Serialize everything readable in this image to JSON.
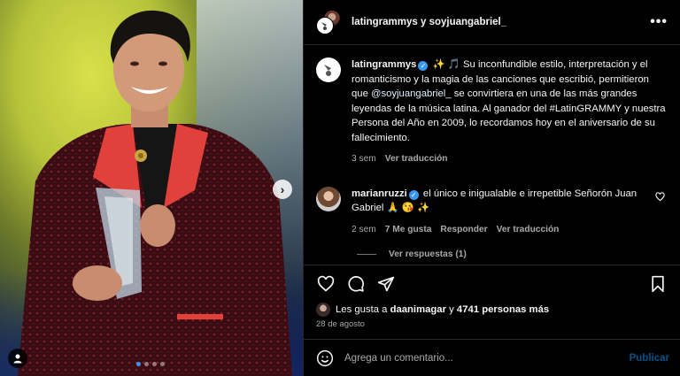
{
  "header": {
    "title": "latingrammys y soyjuangabriel_",
    "more": "•••"
  },
  "caption": {
    "username": "latingrammys",
    "text_1": "✨ 🎵 Su inconfundible estilo, interpretación y el romanticismo y la magia de las canciones que escribió, permitieron que ",
    "mention": "@soyjuangabriel_",
    "text_2": " se convirtiera en una de las más grandes leyendas de la música latina. Al ganador del #LatinGRAMMY y nuestra Persona del Año en 2009, lo recordamos hoy en el aniversario de su fallecimiento.",
    "time": "3 sem",
    "translate": "Ver traducción"
  },
  "comment": {
    "username": "marianruzzi",
    "text": " el único e inigualable e irrepetible Señorón Juan Gabriel 🙏 😘 ✨",
    "time": "2 sem",
    "likes": "7 Me gusta",
    "reply": "Responder",
    "translate": "Ver traducción",
    "view_replies": "Ver respuestas (1)"
  },
  "likes": {
    "prefix": "Les gusta a ",
    "user": "daanimagar",
    "middle": " y ",
    "count": "4741 personas más"
  },
  "date": "28 de agosto",
  "composer": {
    "placeholder": "Agrega un comentario...",
    "publish": "Publicar"
  },
  "carousel": {
    "next_arrow": "›",
    "slide_count": 4,
    "active_slide": 1
  },
  "colors": {
    "background": "#000000",
    "accent_blue": "#0095f6",
    "verified": "#3897f0",
    "muted_text": "#a8a8a8"
  }
}
